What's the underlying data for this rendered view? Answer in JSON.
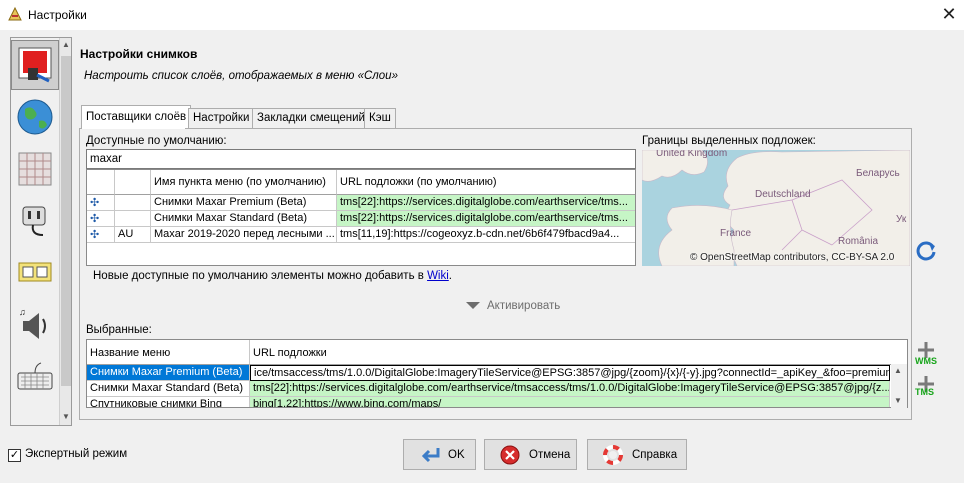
{
  "window": {
    "title": "Настройки",
    "close_glyph": "✕"
  },
  "sidebar": {
    "items": [
      {
        "icon": "paint-preferences-icon"
      },
      {
        "icon": "globe-icon"
      },
      {
        "icon": "grid-projection-icon"
      },
      {
        "icon": "plug-connection-icon"
      },
      {
        "icon": "folder-panels-icon"
      },
      {
        "icon": "audio-speaker-icon"
      },
      {
        "icon": "keyboard-icon"
      }
    ]
  },
  "header": {
    "title": "Настройки снимков",
    "subtitle": "Настроить список слоёв, отображаемых в меню «Слои»"
  },
  "tabs": [
    {
      "label": "Поставщики слоёв"
    },
    {
      "label": "Настройки"
    },
    {
      "label": "Закладки смещений"
    },
    {
      "label": "Кэш"
    }
  ],
  "available": {
    "label": "Доступные по умолчанию:",
    "search_value": "maxar",
    "columns": [
      "",
      "",
      "Имя пункта меню (по умолчанию)",
      "URL подложки (по умолчанию)"
    ],
    "rows": [
      {
        "country": "",
        "name": "Снимки Maxar Premium (Beta)",
        "url": "tms[22]:https://services.digitalglobe.com/earthservice/tms..."
      },
      {
        "country": "",
        "name": "Снимки Maxar Standard (Beta)",
        "url": "tms[22]:https://services.digitalglobe.com/earthservice/tms..."
      },
      {
        "country": "AU",
        "name": "Maxar 2019-2020 перед лесными ...",
        "url": "tms[11,19]:https://cogeoxyz.b-cdn.net/6b6f479fbacd9a4..."
      }
    ]
  },
  "map": {
    "label": "Границы выделенных подложек:",
    "places": [
      "United Kingdom",
      "Deutschland",
      "France",
      "Беларусь",
      "Ук",
      "România"
    ],
    "attribution": "© OpenStreetMap contributors, CC-BY-SA 2.0"
  },
  "hint": {
    "text": "Новые доступные по умолчанию элементы можно добавить в ",
    "link": "Wiki",
    "suffix": "."
  },
  "activate_label": "Активировать",
  "selected": {
    "label": "Выбранные:",
    "columns": [
      "Название меню",
      "URL подложки"
    ],
    "rows": [
      {
        "name": "Снимки Maxar Premium (Beta)",
        "url": "ice/tmsaccess/tms/1.0.0/DigitalGlobe:ImageryTileService@EPSG:3857@jpg/{zoom}/{x}/{-y}.jpg?connectId=_apiKey_&foo=premium"
      },
      {
        "name": "Снимки Maxar Standard (Beta)",
        "url": "tms[22]:https://services.digitalglobe.com/earthservice/tmsaccess/tms/1.0.0/DigitalGlobe:ImageryTileService@EPSG:3857@jpg/{z..."
      },
      {
        "name": "Спутниковые снимки Bing",
        "url": "bing[1,22]:https://www.bing.com/maps/"
      }
    ],
    "add_wms_label": "WMS",
    "add_tms_label": "TMS"
  },
  "footer": {
    "expert_mode_label": "Экспертный режим",
    "expert_checked": "✓",
    "ok_label": "OK",
    "cancel_label": "Отмена",
    "help_label": "Справка"
  }
}
